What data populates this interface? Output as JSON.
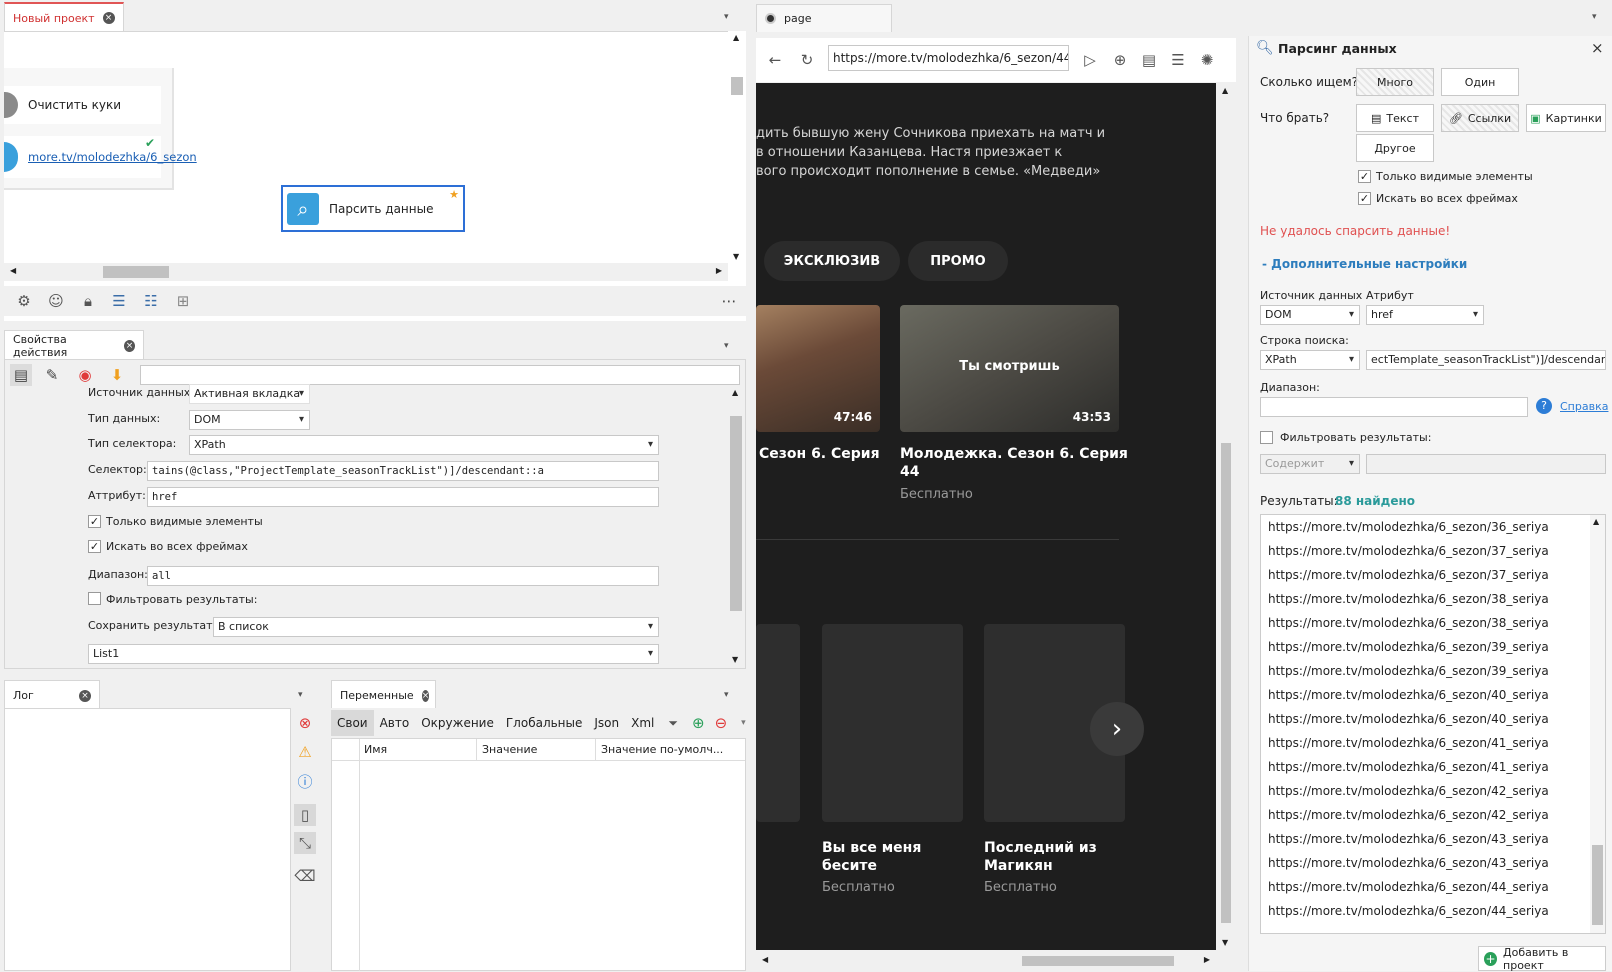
{
  "project": {
    "tab": "Новый проект",
    "node_clear": "Очистить куки",
    "node_link": "more.tv/molodezhka/6_sezon",
    "node_parse": "Парсить данные"
  },
  "props": {
    "tab": "Свойства действия",
    "labels": {
      "source": "Источник данных:",
      "type": "Тип данных:",
      "selector_type": "Тип селектора:",
      "selector": "Селектор:",
      "attribute": "Аттрибут:",
      "range": "Диапазон:",
      "save": "Сохранить результат:"
    },
    "values": {
      "source": "Активная вкладка",
      "type": "DOM",
      "selector_type": "XPath",
      "selector": "tains(@class,\"ProjectTemplate_seasonTrackList\")]/descendant::a",
      "attribute": "href",
      "range": "all",
      "save": "В список",
      "list": "List1"
    },
    "checks": {
      "visible": "Только видимые элементы",
      "frames": "Искать во всех фреймах",
      "filter": "Фильтровать результаты:"
    }
  },
  "log": {
    "tab": "Лог"
  },
  "vars": {
    "tab": "Переменные",
    "tabs": [
      "Свои",
      "Авто",
      "Окружение",
      "Глобальные",
      "Json",
      "Xml"
    ],
    "cols": [
      "Имя",
      "Значение",
      "Значение по-умолч..."
    ]
  },
  "browser": {
    "tab": "page",
    "url": "https://more.tv/molodezhka/6_sezon/44",
    "desc": [
      "дить бывшую жену Сочникова приехать на матч и",
      "в отношении Казанцева. Настя приезжает к",
      "вого происходит пополнение в семье. «Медведи»"
    ],
    "chips": [
      "ЭКСКЛЮЗИВ",
      "ПРОМО"
    ],
    "card1": {
      "duration": "47:46",
      "title": "Сезон 6. Серия"
    },
    "card2": {
      "duration": "43:53",
      "overlay": "Ты смотришь",
      "title": "Молодежка. Сезон 6. Серия",
      "title2": "44",
      "sub": "Бесплатно"
    },
    "card3": {
      "title": "Вы все меня",
      "title2": "бесите",
      "sub": "Бесплатно"
    },
    "card4": {
      "title": "Последний из",
      "title2": "Магикян",
      "sub": "Бесплатно"
    }
  },
  "parse": {
    "title": "Парсинг данных",
    "how_many": "Сколько ищем?",
    "many": "Много",
    "one": "Один",
    "what": "Что брать?",
    "text": "Текст",
    "links": "Ссылки",
    "images": "Картинки",
    "other": "Другое",
    "only_visible": "Только видимые элементы",
    "all_frames": "Искать во всех фреймах",
    "error": "Не удалось спарсить данные!",
    "advanced": "-  Дополнительные настройки",
    "source_lbl": "Источник данных",
    "source_val": "DOM",
    "attr_lbl": "Атрибут",
    "attr_val": "href",
    "search_lbl": "Строка поиска:",
    "search_type": "XPath",
    "search_val": "ectTemplate_seasonTrackList\")]/descendant::a",
    "range_lbl": "Диапазон:",
    "help": "Справка",
    "filter": "Фильтровать результаты:",
    "contains": "Содержит",
    "results_lbl": "Результаты:",
    "results_count": "88 найдено",
    "add_btn": "Добавить в проект",
    "results": [
      "https://more.tv/molodezhka/6_sezon/36_seriya",
      "https://more.tv/molodezhka/6_sezon/37_seriya",
      "https://more.tv/molodezhka/6_sezon/37_seriya",
      "https://more.tv/molodezhka/6_sezon/38_seriya",
      "https://more.tv/molodezhka/6_sezon/38_seriya",
      "https://more.tv/molodezhka/6_sezon/39_seriya",
      "https://more.tv/molodezhka/6_sezon/39_seriya",
      "https://more.tv/molodezhka/6_sezon/40_seriya",
      "https://more.tv/molodezhka/6_sezon/40_seriya",
      "https://more.tv/molodezhka/6_sezon/41_seriya",
      "https://more.tv/molodezhka/6_sezon/41_seriya",
      "https://more.tv/molodezhka/6_sezon/42_seriya",
      "https://more.tv/molodezhka/6_sezon/42_seriya",
      "https://more.tv/molodezhka/6_sezon/43_seriya",
      "https://more.tv/molodezhka/6_sezon/43_seriya",
      "https://more.tv/molodezhka/6_sezon/44_seriya",
      "https://more.tv/molodezhka/6_sezon/44_seriya"
    ]
  }
}
